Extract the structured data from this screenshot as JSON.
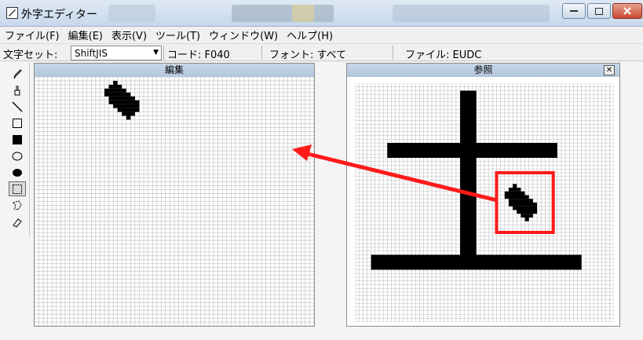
{
  "window": {
    "title": "外字エディター",
    "controls": {
      "minimize": "minimize",
      "maximize": "maximize",
      "close": "close"
    }
  },
  "menu": {
    "items": [
      "ファイル(F)",
      "編集(E)",
      "表示(V)",
      "ツール(T)",
      "ウィンドウ(W)",
      "ヘルプ(H)"
    ]
  },
  "infobar": {
    "charset_label": "文字セット:",
    "charset_value": "ShiftJIS",
    "code": "コード: F040",
    "font": "フォント: すべて",
    "file": "ファイル: EUDC"
  },
  "tools": [
    "pencil-icon",
    "brush-icon",
    "line-icon",
    "hollow-rectangle-icon",
    "filled-rectangle-icon",
    "hollow-ellipse-icon",
    "filled-ellipse-icon",
    "rectangular-selection-icon",
    "freeform-selection-icon",
    "eraser-icon"
  ],
  "selected_tool": "rectangular-selection-icon",
  "edit_panel": {
    "title": "編集",
    "grid_size": 64,
    "glyph_rows": [
      {
        "r": 1,
        "c0": 18,
        "c1": 18
      },
      {
        "r": 2,
        "c0": 17,
        "c1": 19
      },
      {
        "r": 3,
        "c0": 16,
        "c1": 20
      },
      {
        "r": 4,
        "c0": 16,
        "c1": 21
      },
      {
        "r": 5,
        "c0": 17,
        "c1": 22
      },
      {
        "r": 6,
        "c0": 17,
        "c1": 23
      },
      {
        "r": 7,
        "c0": 18,
        "c1": 23
      },
      {
        "r": 8,
        "c0": 19,
        "c1": 23
      },
      {
        "r": 9,
        "c0": 20,
        "c1": 22
      },
      {
        "r": 10,
        "c0": 21,
        "c1": 21
      }
    ]
  },
  "reference_panel": {
    "title": "参照",
    "grid_size": 64,
    "glyph_rects": [
      {
        "c0": 26,
        "c1": 29,
        "r0": 2,
        "r1": 45
      },
      {
        "c0": 8,
        "c1": 49,
        "r0": 16,
        "r1": 19
      },
      {
        "c0": 4,
        "c1": 55,
        "r0": 46,
        "r1": 49
      }
    ],
    "glyph_rows": [
      {
        "r": 27,
        "c0": 39,
        "c1": 39
      },
      {
        "r": 28,
        "c0": 38,
        "c1": 40
      },
      {
        "r": 29,
        "c0": 37,
        "c1": 41
      },
      {
        "r": 30,
        "c0": 37,
        "c1": 42
      },
      {
        "r": 31,
        "c0": 38,
        "c1": 43
      },
      {
        "r": 32,
        "c0": 38,
        "c1": 44
      },
      {
        "r": 33,
        "c0": 39,
        "c1": 44
      },
      {
        "r": 34,
        "c0": 40,
        "c1": 44
      },
      {
        "r": 35,
        "c0": 41,
        "c1": 43
      },
      {
        "r": 36,
        "c0": 42,
        "c1": 42
      }
    ],
    "highlight_box": {
      "c0": 35,
      "c1": 48,
      "r0": 24,
      "r1": 39
    }
  },
  "colors": {
    "annotation": "#ff1a1a",
    "cell_on": "#000000",
    "grid_line": "#bdbdbd",
    "panel_title_bg": "#bccde2"
  }
}
